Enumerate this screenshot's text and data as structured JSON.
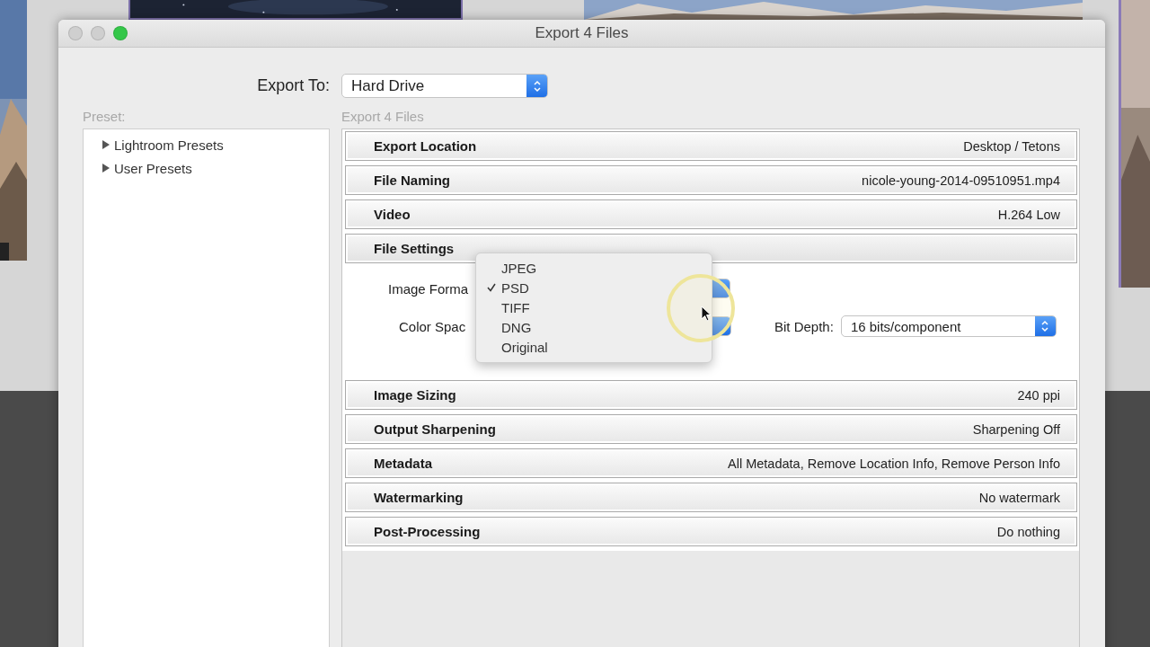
{
  "window": {
    "title": "Export 4 Files",
    "traffic_lights": [
      {
        "kind": "close",
        "active": false
      },
      {
        "kind": "minimize",
        "active": false
      },
      {
        "kind": "zoom",
        "active": true
      }
    ]
  },
  "export_to": {
    "label": "Export To:",
    "value": "Hard Drive"
  },
  "preset": {
    "label": "Preset:",
    "items": [
      {
        "label": "Lightroom Presets",
        "expanded": false
      },
      {
        "label": "User Presets",
        "expanded": false
      }
    ]
  },
  "settings_title": "Export 4 Files",
  "sections": [
    {
      "title": "Export Location",
      "summary": "Desktop / Tetons",
      "expanded": false
    },
    {
      "title": "File Naming",
      "summary": "nicole-young-2014-09510951.mp4",
      "expanded": false
    },
    {
      "title": "Video",
      "summary": "H.264 Low",
      "expanded": false
    },
    {
      "title": "File Settings",
      "expanded": true
    },
    {
      "title": "Image Sizing",
      "summary": "240 ppi",
      "expanded": false
    },
    {
      "title": "Output Sharpening",
      "summary": "Sharpening Off",
      "expanded": false
    },
    {
      "title": "Metadata",
      "summary": "All Metadata, Remove Location Info, Remove Person Info",
      "expanded": false
    },
    {
      "title": "Watermarking",
      "summary": "No watermark",
      "expanded": false
    },
    {
      "title": "Post-Processing",
      "summary": "Do nothing",
      "expanded": false
    }
  ],
  "file_settings": {
    "image_format": {
      "label": "Image Forma"
    },
    "color_space": {
      "label": "Color Spac"
    },
    "bit_depth": {
      "label": "Bit Depth:",
      "value": "16 bits/component"
    }
  },
  "format_menu": {
    "items": [
      {
        "label": "JPEG",
        "selected": false
      },
      {
        "label": "PSD",
        "selected": true
      },
      {
        "label": "TIFF",
        "selected": false
      },
      {
        "label": "DNG",
        "selected": false
      },
      {
        "label": "Original",
        "selected": false
      }
    ]
  }
}
